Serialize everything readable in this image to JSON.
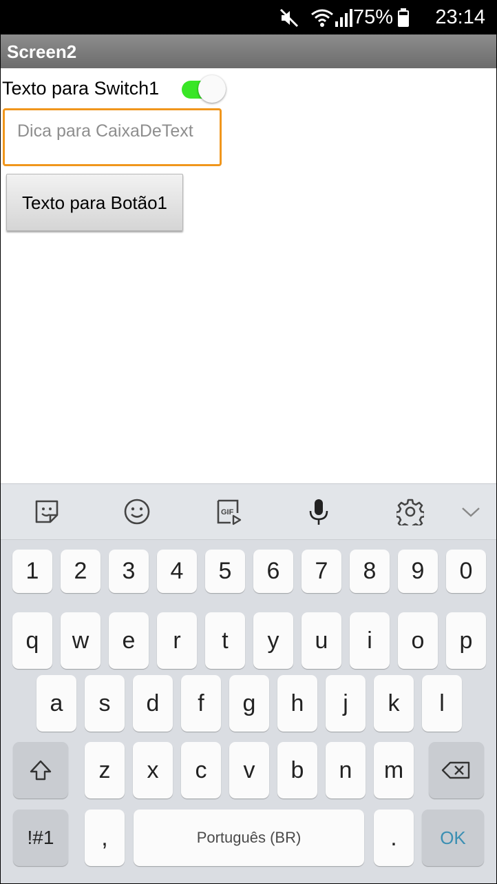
{
  "status_bar": {
    "battery_percent": "75%",
    "time": "23:14"
  },
  "app": {
    "title": "Screen2"
  },
  "content": {
    "switch_label": "Texto para Switch1",
    "switch_on": true,
    "textbox_placeholder": "Dica para CaixaDeText",
    "button_label": "Texto para Botão1"
  },
  "keyboard": {
    "toolbar_icons": [
      "sticker-icon",
      "emoji-icon",
      "gif-icon",
      "microphone-icon",
      "gear-icon",
      "chevron-down-icon"
    ],
    "row_numbers": [
      "1",
      "2",
      "3",
      "4",
      "5",
      "6",
      "7",
      "8",
      "9",
      "0"
    ],
    "row_top": [
      "q",
      "w",
      "e",
      "r",
      "t",
      "y",
      "u",
      "i",
      "o",
      "p"
    ],
    "row_middle": [
      "a",
      "s",
      "d",
      "f",
      "g",
      "h",
      "j",
      "k",
      "l"
    ],
    "row_bottom": [
      "z",
      "x",
      "c",
      "v",
      "b",
      "n",
      "m"
    ],
    "symbols_label": "!#1",
    "comma_label": ",",
    "space_label": "Português (BR)",
    "period_label": ".",
    "ok_label": "OK"
  },
  "colors": {
    "switch_track": "#39e626",
    "textbox_border": "#f0961c",
    "ok_text": "#3b8fb3",
    "titlebar": "#7a7a7a"
  }
}
